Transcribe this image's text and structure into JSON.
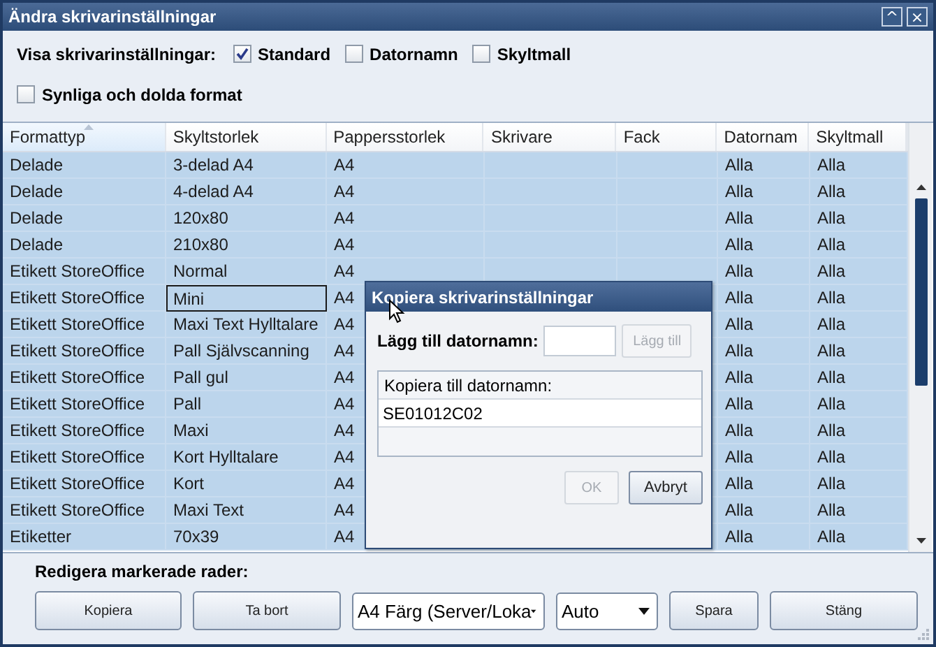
{
  "window": {
    "title": "Ändra skrivarinställningar",
    "buttons": [
      "^",
      "×"
    ]
  },
  "filters": {
    "label": "Visa skrivarinställningar:",
    "options": [
      {
        "label": "Standard",
        "checked": true
      },
      {
        "label": "Datornamn",
        "checked": false
      },
      {
        "label": "Skyltmall",
        "checked": false
      }
    ],
    "extra": {
      "label": "Synliga och dolda format",
      "checked": false
    }
  },
  "table": {
    "columns": [
      "Formattyp",
      "Skyltstorlek",
      "Pappersstorlek",
      "Skrivare",
      "Fack",
      "Datornam",
      "Skyltmall"
    ],
    "rows": [
      {
        "cells": [
          "Delade",
          "3-delad A4",
          "A4",
          "",
          "",
          "Alla",
          "Alla"
        ],
        "selected": true,
        "focused": false
      },
      {
        "cells": [
          "Delade",
          "4-delad A4",
          "A4",
          "",
          "",
          "Alla",
          "Alla"
        ],
        "selected": true,
        "focused": false
      },
      {
        "cells": [
          "Delade",
          "120x80",
          "A4",
          "",
          "",
          "Alla",
          "Alla"
        ],
        "selected": true,
        "focused": false
      },
      {
        "cells": [
          "Delade",
          "210x80",
          "A4",
          "",
          "",
          "Alla",
          "Alla"
        ],
        "selected": true,
        "focused": false
      },
      {
        "cells": [
          "Etikett StoreOffice",
          "Normal",
          "A4",
          "",
          "",
          "Alla",
          "Alla"
        ],
        "selected": true,
        "focused": false
      },
      {
        "cells": [
          "Etikett StoreOffice",
          "Mini",
          "A4",
          "",
          "",
          "Alla",
          "Alla"
        ],
        "selected": true,
        "focused": true
      },
      {
        "cells": [
          "Etikett StoreOffice",
          "Maxi Text Hylltalare",
          "A4",
          "",
          "",
          "Alla",
          "Alla"
        ],
        "selected": true,
        "focused": false
      },
      {
        "cells": [
          "Etikett StoreOffice",
          "Pall Självscanning",
          "A4",
          "",
          "",
          "Alla",
          "Alla"
        ],
        "selected": true,
        "focused": false
      },
      {
        "cells": [
          "Etikett StoreOffice",
          "Pall gul",
          "A4",
          "",
          "",
          "Alla",
          "Alla"
        ],
        "selected": true,
        "focused": false
      },
      {
        "cells": [
          "Etikett StoreOffice",
          "Pall",
          "A4",
          "",
          "",
          "Alla",
          "Alla"
        ],
        "selected": true,
        "focused": false
      },
      {
        "cells": [
          "Etikett StoreOffice",
          "Maxi",
          "A4",
          "",
          "",
          "Alla",
          "Alla"
        ],
        "selected": true,
        "focused": false
      },
      {
        "cells": [
          "Etikett StoreOffice",
          "Kort Hylltalare",
          "A4",
          "",
          "",
          "Alla",
          "Alla"
        ],
        "selected": true,
        "focused": false
      },
      {
        "cells": [
          "Etikett StoreOffice",
          "Kort",
          "A4",
          "",
          "",
          "Alla",
          "Alla"
        ],
        "selected": true,
        "focused": false
      },
      {
        "cells": [
          "Etikett StoreOffice",
          "Maxi Text",
          "A4",
          "",
          "",
          "Alla",
          "Alla"
        ],
        "selected": true,
        "focused": false
      },
      {
        "cells": [
          "Etiketter",
          "70x39",
          "A4",
          "",
          "",
          "Alla",
          "Alla"
        ],
        "selected": true,
        "focused": false
      }
    ]
  },
  "edit_bar": {
    "label": "Redigera markerade rader:",
    "controls": [
      {
        "kind": "button",
        "label": "Kopiera"
      },
      {
        "kind": "button",
        "label": "Ta bort"
      },
      {
        "kind": "dropdown",
        "value": "A4 Färg (Server/Loka"
      },
      {
        "kind": "dropdown",
        "value": "Auto"
      },
      {
        "kind": "button",
        "label": "Spara"
      },
      {
        "kind": "button",
        "label": "Stäng"
      }
    ]
  },
  "dialog": {
    "title": "Kopiera skrivarinställningar",
    "add_label": "Lägg till datornamn:",
    "add_button": {
      "label": "Lägg till",
      "disabled": true
    },
    "list_header": "Kopiera till datornamn:",
    "list_items": [
      "SE01012C02"
    ],
    "buttons": [
      {
        "label": "OK",
        "disabled": true
      },
      {
        "label": "Avbryt",
        "disabled": false
      }
    ]
  }
}
